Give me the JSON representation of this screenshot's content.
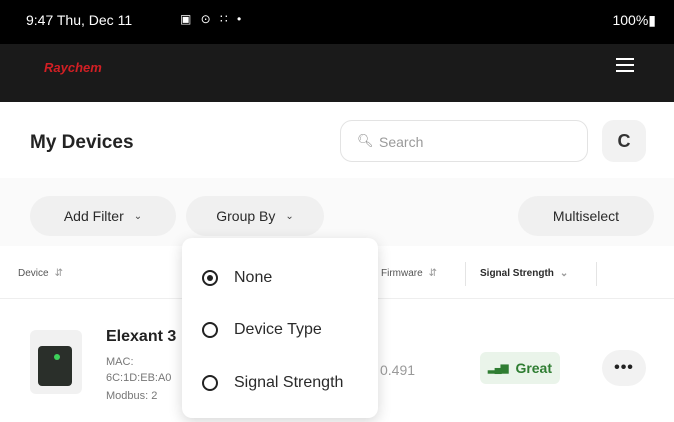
{
  "status_bar": {
    "time_date": "9:47  Thu, Dec 11",
    "icons": "▣ ⊙ ∷  •",
    "battery": "100%▮"
  },
  "app": {
    "brand": "Raychem",
    "menu_icon": "hamburger-icon"
  },
  "header": {
    "title": "My Devices",
    "search_placeholder": "Search",
    "refresh_icon": "C"
  },
  "filters": {
    "add_filter_label": "Add Filter",
    "group_by_label": "Group By",
    "multiselect_label": "Multiselect",
    "chevron": "⌄"
  },
  "table": {
    "columns": {
      "device": "Device",
      "firmware": "Firmware",
      "signal": "Signal Strength"
    },
    "sort_glyph": "⇵",
    "sort_active": "⌄"
  },
  "devices": [
    {
      "name": "Elexant 3",
      "mac_label": "MAC:",
      "mac_value": "6C:1D:EB:A0",
      "modbus": "Modbus: 2",
      "firmware": "0.491",
      "signal_icon": "signal-bars-icon",
      "signal_text": "Great",
      "more": "•••"
    }
  ],
  "group_by_menu": {
    "options": [
      {
        "label": "None",
        "selected": true
      },
      {
        "label": "Device Type",
        "selected": false
      },
      {
        "label": "Signal Strength",
        "selected": false
      }
    ]
  },
  "colors": {
    "brand": "#d21f24",
    "signal_great": "#2f7d32",
    "status_bar": "#000000"
  }
}
